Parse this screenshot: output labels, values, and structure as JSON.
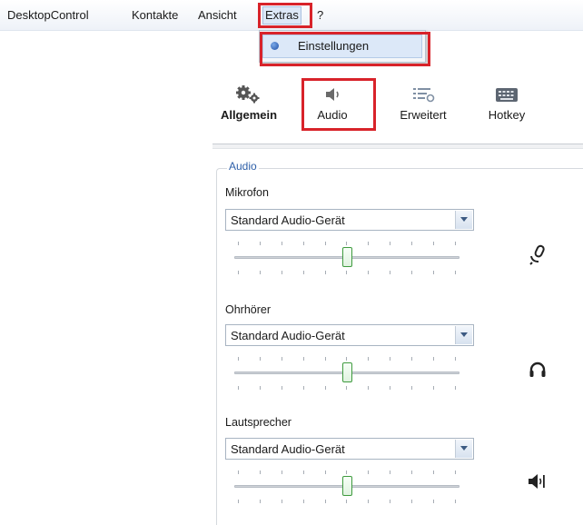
{
  "menubar": {
    "items": [
      "DesktopControl",
      "Kontakte",
      "Ansicht",
      "Extras",
      "?"
    ]
  },
  "dropdown": {
    "item_label": "Einstellungen"
  },
  "tabs": {
    "allgemein": "Allgemein",
    "audio": "Audio",
    "erweitert": "Erweitert",
    "hotkey": "Hotkey"
  },
  "audio_group": {
    "title": "Audio",
    "mikrofon": {
      "label": "Mikrofon",
      "device": "Standard Audio-Gerät",
      "level": 0.5,
      "icon": "microphone-icon"
    },
    "ohrhoerer": {
      "label": "Ohrhörer",
      "device": "Standard Audio-Gerät",
      "level": 0.5,
      "icon": "headphones-icon"
    },
    "lautsprecher": {
      "label": "Lautsprecher",
      "device": "Standard Audio-Gerät",
      "level": 0.5,
      "icon": "speaker-icon"
    }
  },
  "colors": {
    "highlight_box": "#d8232a",
    "group_title": "#2d5fa8",
    "slider_thumb": "#3f9b3f"
  }
}
